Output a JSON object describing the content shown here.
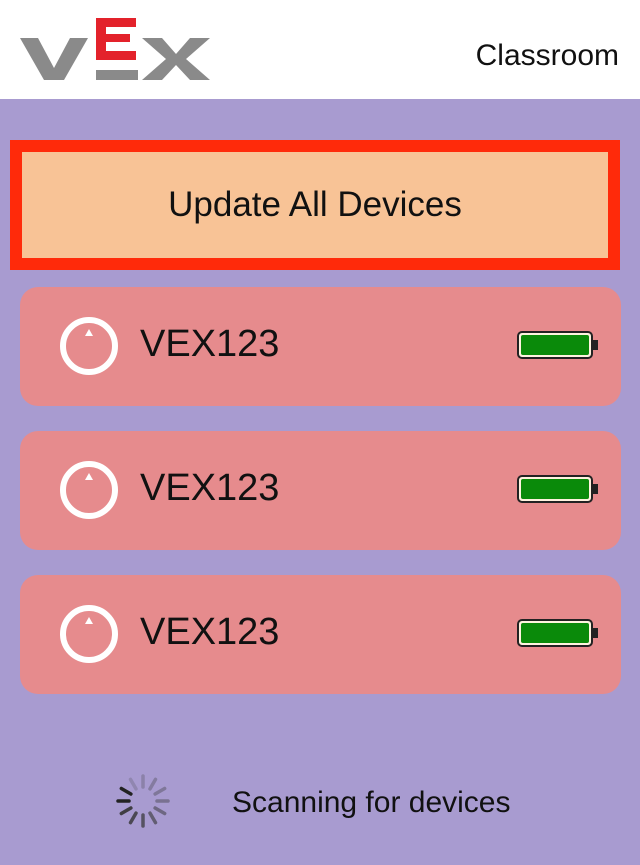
{
  "header": {
    "logo_text": "VEX",
    "title": "Classroom"
  },
  "update_button": {
    "label": "Update All Devices"
  },
  "devices": [
    {
      "name": "VEX123",
      "icon": "robot-icon",
      "battery_level": 1.0
    },
    {
      "name": "VEX123",
      "icon": "robot-icon",
      "battery_level": 1.0
    },
    {
      "name": "VEX123",
      "icon": "robot-icon",
      "battery_level": 1.0
    }
  ],
  "status": {
    "scan_text": "Scanning for devices",
    "icon": "loading-spinner-icon"
  },
  "colors": {
    "background": "#a89bd0",
    "header_bg": "#ffffff",
    "update_fill": "#f8c396",
    "update_border": "#ff2a0a",
    "device_card": "#e68b8d",
    "battery_green": "#0a8a0a",
    "logo_gray": "#8a8a8a",
    "logo_red": "#e3222b"
  }
}
